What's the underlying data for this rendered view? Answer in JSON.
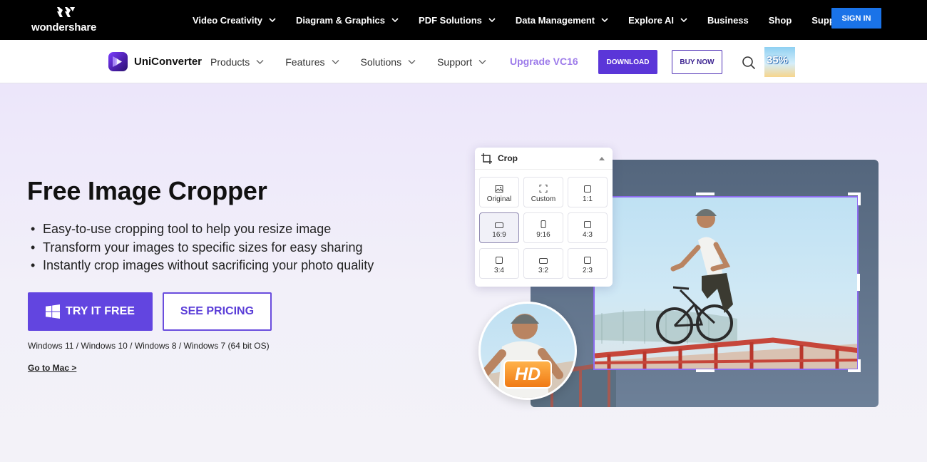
{
  "topbar": {
    "brand": "wondershare",
    "nav": [
      {
        "label": "Video Creativity",
        "dropdown": true
      },
      {
        "label": "Diagram & Graphics",
        "dropdown": true
      },
      {
        "label": "PDF Solutions",
        "dropdown": true
      },
      {
        "label": "Data Management",
        "dropdown": true
      },
      {
        "label": "Explore AI",
        "dropdown": true
      },
      {
        "label": "Business",
        "dropdown": false
      },
      {
        "label": "Shop",
        "dropdown": false
      },
      {
        "label": "Support",
        "dropdown": false
      }
    ],
    "signin": "SIGN IN",
    "signin_color": "#1a73e8"
  },
  "productbar": {
    "name": "UniConverter",
    "nav": [
      {
        "label": "Products"
      },
      {
        "label": "Features"
      },
      {
        "label": "Solutions"
      },
      {
        "label": "Support"
      }
    ],
    "upgrade": "Upgrade VC16",
    "download": "DOWNLOAD",
    "buy": "BUY NOW",
    "promo": "35%",
    "accent": "#5b36d8"
  },
  "hero": {
    "title": "Free Image Cropper",
    "bullets": [
      "Easy-to-use cropping tool to help you resize image",
      "Transform your images to specific sizes for easy sharing",
      "Instantly crop images without sacrificing your photo quality"
    ],
    "try_button": "TRY IT FREE",
    "pricing_button": "SEE PRICING",
    "os_note": "Windows 11 / Windows 10 / Windows 8 / Windows 7 (64 bit OS)",
    "mac_link": "Go to Mac >"
  },
  "crop_panel": {
    "title": "Crop",
    "options": [
      {
        "label": "Original",
        "icon": "image-icon"
      },
      {
        "label": "Custom",
        "icon": "custom-frame-icon"
      },
      {
        "label": "1:1",
        "icon": "square-icon"
      },
      {
        "label": "16:9",
        "icon": "landscape-icon",
        "selected": true
      },
      {
        "label": "9:16",
        "icon": "portrait-icon"
      },
      {
        "label": "4:3",
        "icon": "square-icon"
      },
      {
        "label": "3:4",
        "icon": "square-icon"
      },
      {
        "label": "3:2",
        "icon": "landscape-icon"
      },
      {
        "label": "2:3",
        "icon": "square-icon"
      }
    ]
  },
  "hd_badge": "HD"
}
